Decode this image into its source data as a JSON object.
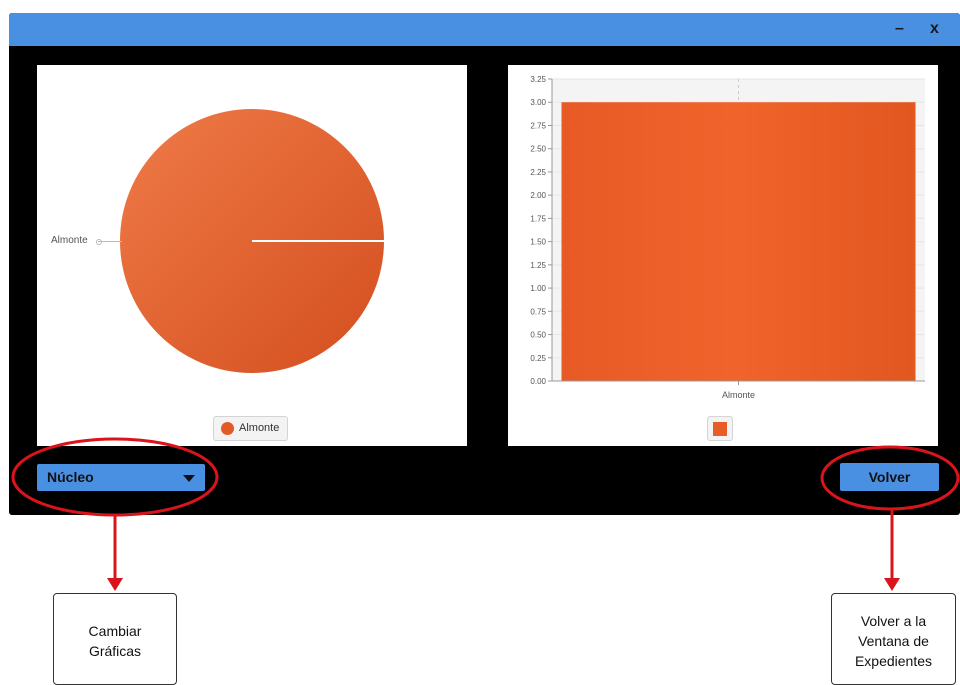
{
  "window": {
    "minimize_label": "–",
    "close_label": "x",
    "titlebar_color": "#4a90e2",
    "background_color": "#000000"
  },
  "pie_chart": {
    "slice_label": "Almonte",
    "legend_label": "Almonte",
    "slice_color": "#e25a25"
  },
  "bar_chart": {
    "category_label": "Almonte",
    "bar_color": "#e85d27",
    "y_ticks": [
      "0.00",
      "0.25",
      "0.50",
      "0.75",
      "1.00",
      "1.25",
      "1.50",
      "1.75",
      "2.00",
      "2.25",
      "2.50",
      "2.75",
      "3.00",
      "3.25"
    ]
  },
  "chart_data": [
    {
      "type": "pie",
      "categories": [
        "Almonte"
      ],
      "values": [
        1
      ],
      "legend": [
        "Almonte"
      ]
    },
    {
      "type": "bar",
      "categories": [
        "Almonte"
      ],
      "values": [
        3.0
      ],
      "ylim": [
        0,
        3.25
      ],
      "y_tick_step": 0.25,
      "grid": true
    }
  ],
  "controls": {
    "combo_value": "Núcleo",
    "volver_label": "Volver"
  },
  "annotations": {
    "callout_left_line1": "Cambiar",
    "callout_left_line2": "Gráficas",
    "callout_right_line1": "Volver a la",
    "callout_right_line2": "Ventana de",
    "callout_right_line3": "Expedientes",
    "highlight_color": "#d9141b"
  }
}
